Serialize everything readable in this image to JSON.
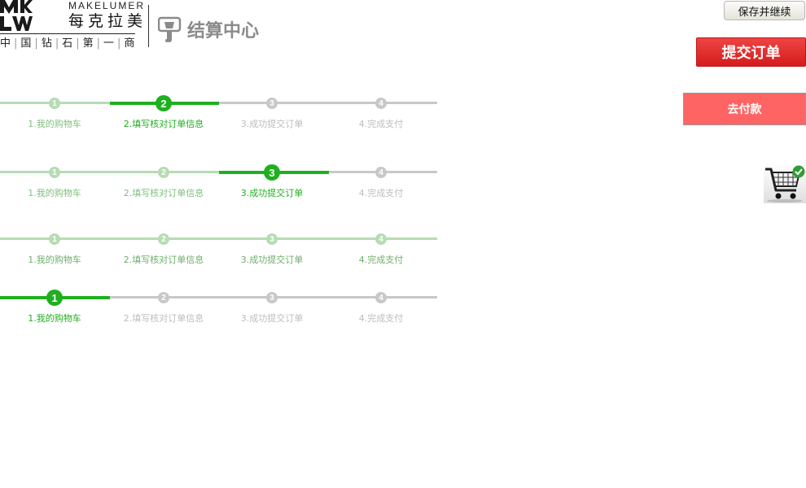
{
  "header": {
    "brand_en": "MAKELUMER",
    "brand_cn": "每克拉美",
    "brand_mark": "MKLW",
    "tagline": [
      "中",
      "国",
      "钻",
      "石",
      "第",
      "一",
      "商"
    ],
    "page_title": "结算中心"
  },
  "actions": {
    "save_continue": "保存并继续",
    "submit_order": "提交订单",
    "go_pay": "去付款"
  },
  "icons": {
    "cart": "shopping-cart-check-icon",
    "title_badge": "cart-badge-icon"
  },
  "colors": {
    "active_green": "#1eb01e",
    "done_green": "#b6dcb4",
    "inactive_gray": "#c8c8c8",
    "submit_red": "#e02a2a",
    "pay_red": "#ff6464"
  },
  "steps": [
    {
      "number": "1",
      "label": "1.我的购物车"
    },
    {
      "number": "2",
      "label": "2.填写核对订单信息"
    },
    {
      "number": "3",
      "label": "3.成功提交订单"
    },
    {
      "number": "4",
      "label": "4.完成支付"
    }
  ],
  "progress_bars": [
    {
      "current_step": 2
    },
    {
      "current_step": 3
    },
    {
      "current_step": 4,
      "all_done": true
    },
    {
      "current_step": 1
    }
  ]
}
